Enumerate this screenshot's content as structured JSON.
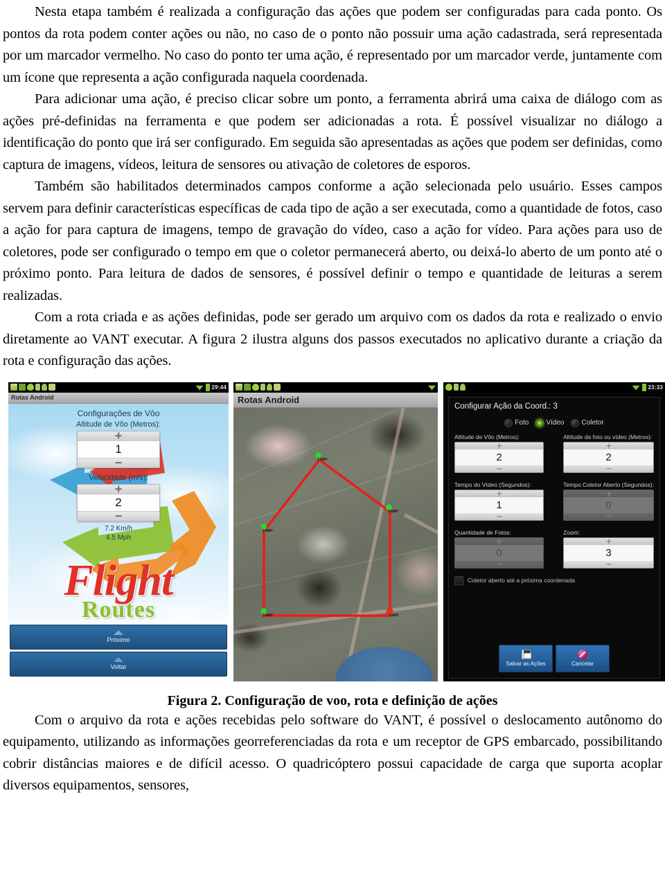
{
  "document": {
    "paragraphs": [
      "Nesta etapa também é realizada a configuração das ações que podem ser configuradas para cada ponto. Os pontos da rota podem conter ações ou não, no caso de o ponto não possuir uma ação cadastrada, será representada por um marcador vermelho. No caso do ponto ter uma ação, é representado por um marcador verde, juntamente com um ícone que representa a ação configurada naquela coordenada.",
      "Para adicionar uma ação, é preciso clicar sobre um ponto, a ferramenta abrirá uma caixa de diálogo com as ações pré-definidas na ferramenta e que podem ser adicionadas a rota. É possível visualizar no diálogo a identificação do ponto que irá ser configurado. Em seguida são apresentadas as ações que podem ser definidas, como captura de imagens, vídeos, leitura de sensores ou ativação de coletores de esporos.",
      "Também são habilitados determinados campos conforme a ação selecionada pelo usuário. Esses campos servem para definir características específicas de cada tipo de ação a ser executada, como a quantidade de fotos, caso a ação for para captura de imagens, tempo de gravação do vídeo, caso a ação for vídeo. Para ações para uso de coletores, pode ser configurado o tempo em que o coletor permanecerá aberto, ou deixá-lo aberto de um ponto até o próximo ponto. Para leitura de dados de sensores, é possível definir o tempo e quantidade de leituras a serem realizadas.",
      "Com a rota criada e as ações definidas, pode ser gerado um arquivo com os dados da rota e realizado o envio diretamente ao VANT executar. A figura 2 ilustra alguns dos passos executados no aplicativo durante a criação da rota e configuração das ações."
    ],
    "figure_caption": "Figura 2. Configuração de voo, rota e definição de ações",
    "paragraph_after_figure": "Com o arquivo da rota e ações recebidas pelo software do VANT, é possível o deslocamento autônomo do equipamento, utilizando as informações georreferenciadas da rota e um receptor de GPS embarcado, possibilitando cobrir distâncias maiores e de difícil acesso. O quadricóptero possui capacidade de carga que suporta acoplar diversos equipamentos, sensores,"
  },
  "screenshot1": {
    "status_time": "29:44",
    "app_title": "Rotas Android",
    "heading": "Configurações de Vôo",
    "altitude_label": "Altitude de Vôo (Metros):",
    "altitude_value": "1",
    "speed_label": "Velocidade (m/s):",
    "speed_value": "2",
    "speed_kmh": "7.2 Km/h",
    "speed_mph": "4.5 Mph",
    "logo_line1": "Flight",
    "logo_line2": "Routes",
    "next_button": "Próximo",
    "back_button": "Voltar"
  },
  "screenshot2": {
    "app_title": "Rotas Android",
    "markers": [
      {
        "type": "green",
        "x": 41,
        "y": 17
      },
      {
        "type": "green",
        "x": 78,
        "y": 37
      },
      {
        "type": "green",
        "x": 20,
        "y": 44
      },
      {
        "type": "green",
        "x": 12,
        "y": 73
      },
      {
        "type": "red",
        "x": 77,
        "y": 73
      }
    ]
  },
  "screenshot3": {
    "status_time": "23:33",
    "dialog_title": "Configurar Ação da Coord.: 3",
    "actions": [
      {
        "label": "Foto",
        "selected": false
      },
      {
        "label": "Vídeo",
        "selected": true
      },
      {
        "label": "Coletor",
        "selected": false
      }
    ],
    "fields": [
      {
        "label": "Altitude de Vôo (Metros):",
        "value": "2",
        "enabled": true
      },
      {
        "label": "Altitude da foto ou vídeo (Metros):",
        "value": "2",
        "enabled": true
      },
      {
        "label": "Tempo do Vídeo (Segundos):",
        "value": "1",
        "enabled": true
      },
      {
        "label": "Tempo Coletor Aberto (Segundos):",
        "value": "0",
        "enabled": false
      },
      {
        "label": "Quantidade de Fotos:",
        "value": "0",
        "enabled": false
      },
      {
        "label": "Zoom:",
        "value": "3",
        "enabled": true
      }
    ],
    "checkbox_label": "Coletor aberto até a próxima coordenada",
    "save_button": "Salvar as Ações",
    "cancel_button": "Cancelar"
  },
  "colors": {
    "route_line": "#ee1c16",
    "marker_green": "#31d430",
    "marker_red": "#ee2b1c",
    "android_accent": "#86c232",
    "button_blue": "#2f74b5",
    "logo_red": "#e03127",
    "logo_green": "#8bbf2a"
  }
}
